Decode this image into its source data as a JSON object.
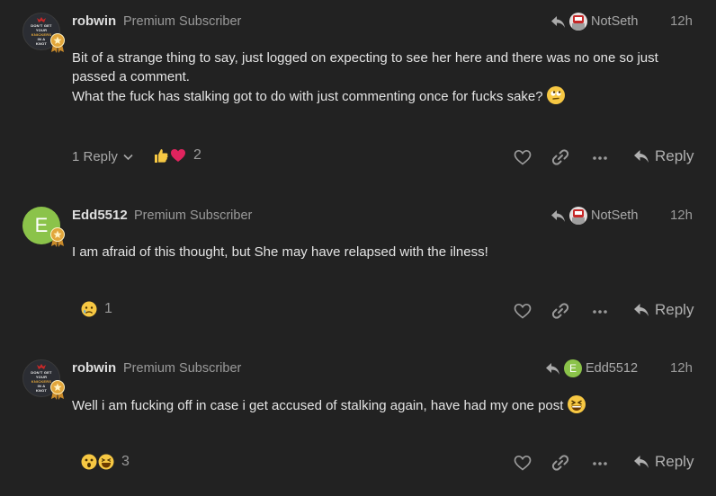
{
  "posts": [
    {
      "username": "robwin",
      "user_title": "Premium Subscriber",
      "avatar_text": [
        "DON'T GET",
        "YOUR",
        "KNICKERS",
        "IN A",
        "KNOT"
      ],
      "reply_to_user": "NotSeth",
      "time": "12h",
      "content_lines": [
        "Bit of a strange thing to say, just logged on expecting to see her here and there was no one so just passed a comment.",
        "What the fuck has stalking got to do with just commenting once for fucks sake?"
      ],
      "replies_label": "1 Reply",
      "reaction_count": "2",
      "reply_label": "Reply"
    },
    {
      "username": "Edd5512",
      "user_title": "Premium Subscriber",
      "avatar_letter": "E",
      "reply_to_user": "NotSeth",
      "time": "12h",
      "content_lines": [
        "I am afraid of this thought, but She may have relapsed with the ilness!"
      ],
      "reaction_count": "1",
      "reply_label": "Reply"
    },
    {
      "username": "robwin",
      "user_title": "Premium Subscriber",
      "avatar_text": [
        "DON'T GET",
        "YOUR",
        "KNICKERS",
        "IN A",
        "KNOT"
      ],
      "reply_to_user": "Edd5512",
      "reply_to_avatar_letter": "E",
      "time": "12h",
      "content_lines": [
        "Well i am fucking off in case i get accused of stalking again, have had my one post"
      ],
      "reaction_count": "3",
      "reply_label": "Reply"
    }
  ],
  "colors": {
    "background": "#222222",
    "edd_avatar": "#8bc34a",
    "flair_gold": "#e2a63b",
    "heart": "#e0245e",
    "emoji_yellow": "#f7c843"
  }
}
